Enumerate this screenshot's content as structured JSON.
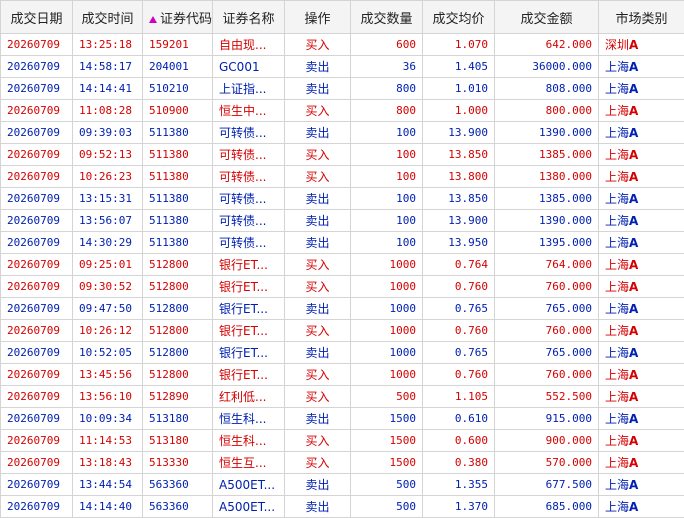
{
  "headers": {
    "date": "成交日期",
    "time": "成交时间",
    "code": "证券代码",
    "name": "证券名称",
    "op": "操作",
    "qty": "成交数量",
    "price": "成交均价",
    "amount": "成交金额",
    "market": "市场类别"
  },
  "colors": {
    "buy": "#d60000",
    "sell": "#0020b0",
    "sort_indicator": "#d000c0"
  },
  "sort_icon": "sort-ascending-triangle-icon",
  "rows": [
    {
      "side": "buy",
      "date": "20260709",
      "time": "13:25:18",
      "code": "159201",
      "name": "自由现...",
      "op": "买入",
      "qty": "600",
      "price": "1.070",
      "amount": "642.000",
      "market": "深圳",
      "market_suffix": "A"
    },
    {
      "side": "sell",
      "date": "20260709",
      "time": "14:58:17",
      "code": "204001",
      "name": "GC001",
      "op": "卖出",
      "qty": "36",
      "price": "1.405",
      "amount": "36000.000",
      "market": "上海",
      "market_suffix": "A"
    },
    {
      "side": "sell",
      "date": "20260709",
      "time": "14:14:41",
      "code": "510210",
      "name": "上证指...",
      "op": "卖出",
      "qty": "800",
      "price": "1.010",
      "amount": "808.000",
      "market": "上海",
      "market_suffix": "A"
    },
    {
      "side": "buy",
      "date": "20260709",
      "time": "11:08:28",
      "code": "510900",
      "name": "恒生中...",
      "op": "买入",
      "qty": "800",
      "price": "1.000",
      "amount": "800.000",
      "market": "上海",
      "market_suffix": "A"
    },
    {
      "side": "sell",
      "date": "20260709",
      "time": "09:39:03",
      "code": "511380",
      "name": "可转债...",
      "op": "卖出",
      "qty": "100",
      "price": "13.900",
      "amount": "1390.000",
      "market": "上海",
      "market_suffix": "A"
    },
    {
      "side": "buy",
      "date": "20260709",
      "time": "09:52:13",
      "code": "511380",
      "name": "可转债...",
      "op": "买入",
      "qty": "100",
      "price": "13.850",
      "amount": "1385.000",
      "market": "上海",
      "market_suffix": "A"
    },
    {
      "side": "buy",
      "date": "20260709",
      "time": "10:26:23",
      "code": "511380",
      "name": "可转债...",
      "op": "买入",
      "qty": "100",
      "price": "13.800",
      "amount": "1380.000",
      "market": "上海",
      "market_suffix": "A"
    },
    {
      "side": "sell",
      "date": "20260709",
      "time": "13:15:31",
      "code": "511380",
      "name": "可转债...",
      "op": "卖出",
      "qty": "100",
      "price": "13.850",
      "amount": "1385.000",
      "market": "上海",
      "market_suffix": "A"
    },
    {
      "side": "sell",
      "date": "20260709",
      "time": "13:56:07",
      "code": "511380",
      "name": "可转债...",
      "op": "卖出",
      "qty": "100",
      "price": "13.900",
      "amount": "1390.000",
      "market": "上海",
      "market_suffix": "A"
    },
    {
      "side": "sell",
      "date": "20260709",
      "time": "14:30:29",
      "code": "511380",
      "name": "可转债...",
      "op": "卖出",
      "qty": "100",
      "price": "13.950",
      "amount": "1395.000",
      "market": "上海",
      "market_suffix": "A"
    },
    {
      "side": "buy",
      "date": "20260709",
      "time": "09:25:01",
      "code": "512800",
      "name": "银行ET...",
      "op": "买入",
      "qty": "1000",
      "price": "0.764",
      "amount": "764.000",
      "market": "上海",
      "market_suffix": "A"
    },
    {
      "side": "buy",
      "date": "20260709",
      "time": "09:30:52",
      "code": "512800",
      "name": "银行ET...",
      "op": "买入",
      "qty": "1000",
      "price": "0.760",
      "amount": "760.000",
      "market": "上海",
      "market_suffix": "A"
    },
    {
      "side": "sell",
      "date": "20260709",
      "time": "09:47:50",
      "code": "512800",
      "name": "银行ET...",
      "op": "卖出",
      "qty": "1000",
      "price": "0.765",
      "amount": "765.000",
      "market": "上海",
      "market_suffix": "A"
    },
    {
      "side": "buy",
      "date": "20260709",
      "time": "10:26:12",
      "code": "512800",
      "name": "银行ET...",
      "op": "买入",
      "qty": "1000",
      "price": "0.760",
      "amount": "760.000",
      "market": "上海",
      "market_suffix": "A"
    },
    {
      "side": "sell",
      "date": "20260709",
      "time": "10:52:05",
      "code": "512800",
      "name": "银行ET...",
      "op": "卖出",
      "qty": "1000",
      "price": "0.765",
      "amount": "765.000",
      "market": "上海",
      "market_suffix": "A"
    },
    {
      "side": "buy",
      "date": "20260709",
      "time": "13:45:56",
      "code": "512800",
      "name": "银行ET...",
      "op": "买入",
      "qty": "1000",
      "price": "0.760",
      "amount": "760.000",
      "market": "上海",
      "market_suffix": "A"
    },
    {
      "side": "buy",
      "date": "20260709",
      "time": "13:56:10",
      "code": "512890",
      "name": "红利低...",
      "op": "买入",
      "qty": "500",
      "price": "1.105",
      "amount": "552.500",
      "market": "上海",
      "market_suffix": "A"
    },
    {
      "side": "sell",
      "date": "20260709",
      "time": "10:09:34",
      "code": "513180",
      "name": "恒生科...",
      "op": "卖出",
      "qty": "1500",
      "price": "0.610",
      "amount": "915.000",
      "market": "上海",
      "market_suffix": "A"
    },
    {
      "side": "buy",
      "date": "20260709",
      "time": "11:14:53",
      "code": "513180",
      "name": "恒生科...",
      "op": "买入",
      "qty": "1500",
      "price": "0.600",
      "amount": "900.000",
      "market": "上海",
      "market_suffix": "A"
    },
    {
      "side": "buy",
      "date": "20260709",
      "time": "13:18:43",
      "code": "513330",
      "name": "恒生互...",
      "op": "买入",
      "qty": "1500",
      "price": "0.380",
      "amount": "570.000",
      "market": "上海",
      "market_suffix": "A"
    },
    {
      "side": "sell",
      "date": "20260709",
      "time": "13:44:54",
      "code": "563360",
      "name": "A500ET...",
      "op": "卖出",
      "qty": "500",
      "price": "1.355",
      "amount": "677.500",
      "market": "上海",
      "market_suffix": "A"
    },
    {
      "side": "sell",
      "date": "20260709",
      "time": "14:14:40",
      "code": "563360",
      "name": "A500ET...",
      "op": "卖出",
      "qty": "500",
      "price": "1.370",
      "amount": "685.000",
      "market": "上海",
      "market_suffix": "A"
    }
  ]
}
